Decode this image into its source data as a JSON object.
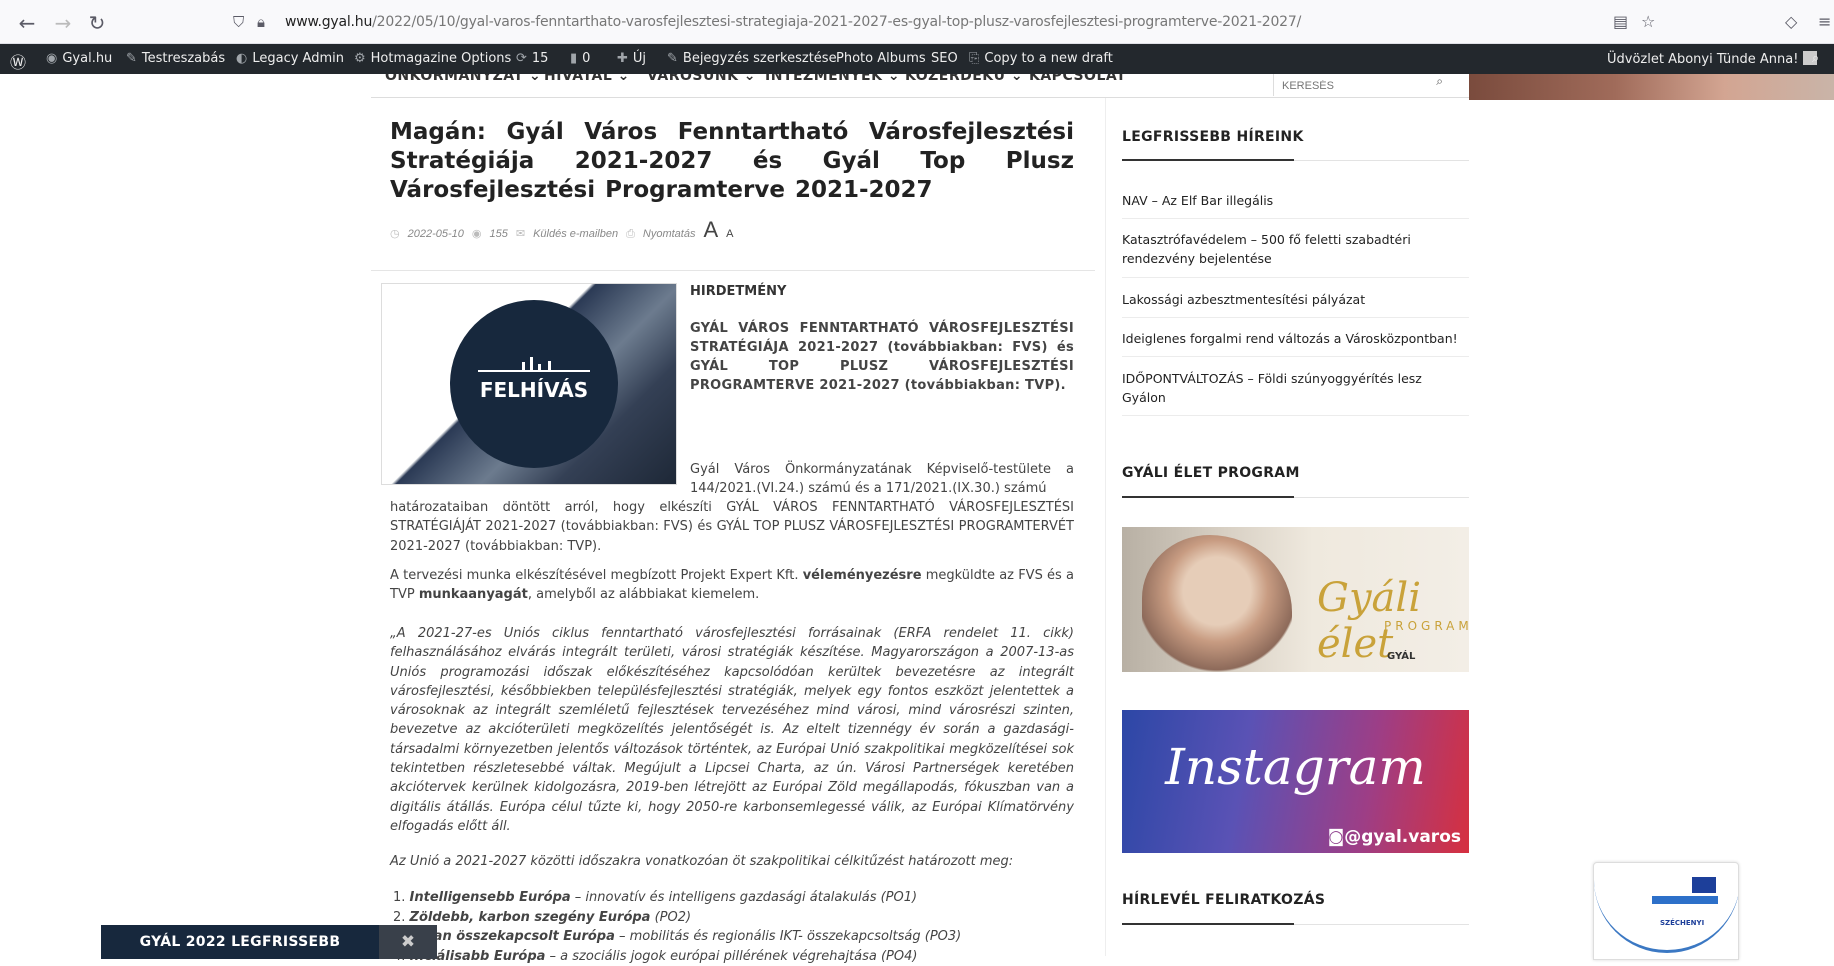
{
  "browser": {
    "url_host": "www.gyal.hu",
    "url_path": "/2022/05/10/gyal-varos-fenntarthato-varosfejlesztesi-strategiaja-2021-2027-es-gyal-top-plusz-varosfejlesztesi-programterve-2021-2027/"
  },
  "adminbar": {
    "site": "Gyal.hu",
    "customize": "Testreszabás",
    "legacy": "Legacy Admin",
    "hotmag": "Hotmagazine Options",
    "updates": "15",
    "comments": "0",
    "new": "Új",
    "edit": "Bejegyzés szerkesztése",
    "photo_albums": "Photo Albums",
    "seo": "SEO",
    "copy_draft": "Copy to a new draft",
    "greeting": "Üdvözlet Abonyi Tünde Anna!"
  },
  "sitenav": {
    "items": [
      "ÖNKORMÁNYZAT",
      "HIVATAL",
      "VÁROSUNK",
      "INTÉZMÉNYEK",
      "KÖZÉRDEKŰ",
      "KAPCSOLAT"
    ],
    "search_placeholder": "KERESÉS"
  },
  "article": {
    "title": "Magán: Gyál Város Fenntartható Városfejlesztési Stratégiája 2021-2027 és Gyál Top Plusz Városfejlesztési Programterve 2021-2027",
    "date": "2022-05-10",
    "views": "155",
    "email": "Küldés e-mailben",
    "print": "Nyomtatás",
    "font_big": "A",
    "font_small": "A",
    "image_caption": "FELHÍVÁS",
    "heading": "HIRDETMÉNY",
    "intro": "GYÁL VÁROS FENNTARTHATÓ VÁROSFEJLESZTÉSI STRATÉGIÁJA 2021-2027 (továbbiakban: FVS) és GYÁL TOP PLUSZ VÁROSFEJLESZTÉSI PROGRAMTERVE 2021-2027 (továbbiakban: TVP).",
    "para1_part1": "Gyál Város Önkormányzatának Képviselő-testülete a 144/2021.(VI.24.) számú és a 171/2021.(IX.30.) számú",
    "para1_part2": "határozataiban döntött arról, hogy elkészíti GYÁL VÁROS FENNTARTHATÓ VÁROSFEJLESZTÉSI STRATÉGIÁJÁT 2021-2027 (továbbiakban: FVS) és GYÁL TOP PLUSZ VÁROSFEJLESZTÉSI PROGRAMTERVÉT 2021-2027 (továbbiakban: TVP).",
    "para2_a": "A tervezési munka elkészítésével megbízott Projekt Expert Kft. ",
    "para2_b": "véleményezésre",
    "para2_c": " megküldte az FVS és a TVP ",
    "para2_d": "munkaanyagát",
    "para2_e": ", amelyből az alábbiakat kiemelem.",
    "quote": "„A 2021-27-es Uniós ciklus fenntartható városfejlesztési forrásainak (ERFA rendelet 11. cikk) felhasználásához elvárás integrált területi, városi stratégiák készítése. Magyarországon a 2007-13-as Uniós programozási időszak előkészítéséhez kapcsolódóan kerültek bevezetésre az integrált városfejlesztési, későbbiekben településfejlesztési stratégiák, melyek egy fontos eszközt jelentettek a városoknak az integrált szemléletű fejlesztések tervezéséhez mind városi, mind városrészi szinten, bevezetve az akcióterületi megközelítés jelentőségét is. Az eltelt tizennégy év során a gazdasági-társadalmi környezetben jelentős változások történtek, az Európai Unió szakpolitikai megközelítései sok tekintetben részletesebbé váltak. Megújult a Lipcsei Charta, az ún. Városi Partnerségek keretében akciótervek kerülnek kidolgozásra, 2019-ben létrejött az Európai Zöld megállapodás, fókuszban van a digitális átállás. Európa célul tűzte ki, hogy 2050-re karbonsemlegessé válik, az Európai Klímatörvény elfogadás előtt áll.",
    "union_line": "Az Unió a 2021-2027 közötti időszakra vonatkozóan öt szakpolitikai célkitűzést határozott meg:",
    "list": [
      {
        "num": "1.",
        "bold": "Intelligensebb Európa",
        "rest": " – innovatív és intelligens gazdasági átalakulás (PO1)"
      },
      {
        "num": "2.",
        "bold": "Zöldebb, karbon szegény Európa",
        "rest": " (PO2)"
      },
      {
        "num": "3.",
        "bold": "...ban összekapcsolt Európa",
        "rest": " – mobilitás és regionális IKT- összekapcsoltság (PO3)"
      },
      {
        "num": "4.",
        "bold": "...ciálisabb Európa",
        "rest": " – a szociális jogok európai pillérének végrehajtása (PO4)"
      }
    ]
  },
  "sidebar": {
    "latest_title": "LEGFRISSEBB HÍREINK",
    "news": [
      "NAV – Az Elf Bar illegális",
      "Katasztrófavédelem – 500 fő feletti szabadtéri rendezvény bejelentése",
      "Lakossági azbesztmentesítési pályázat",
      "Ideiglenes forgalmi rend változás a Városközpontban!",
      "IDŐPONTVÁLTOZÁS – Földi szúnyoggyérítés lesz Gyálon"
    ],
    "gyali_title": "GYÁLI ÉLET PROGRAM",
    "gyali_script": "Gyáli élet",
    "gyali_program": "PROGRAM",
    "gyali_logo": "GYÁL",
    "insta_word": "Instagram",
    "insta_handle": "@gyal.varos",
    "newsletter_title": "HÍRLEVÉL FELIRATKOZÁS"
  },
  "floatbar": {
    "label": "GYÁL 2022 LEGFRISSEBB",
    "close": "✖"
  },
  "eu_badge": {
    "text": "SZÉCHENYI"
  }
}
